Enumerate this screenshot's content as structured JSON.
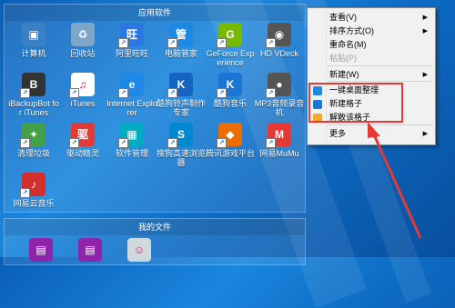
{
  "colors": {
    "accent_red": "#e53935",
    "menu_bg": "#f1f1f1",
    "fence_title_text": "#ffffff"
  },
  "fence_apps": {
    "title": "应用软件",
    "icons": [
      {
        "label": "计算机",
        "icon": "computer-icon",
        "color": "#3b7fc4",
        "glyph": "▣"
      },
      {
        "label": "回收站",
        "icon": "recycle-bin-icon",
        "color": "#7da7c9",
        "glyph": "♻"
      },
      {
        "label": "阿里旺旺",
        "icon": "aliwangwang-icon",
        "color": "#2b78e4",
        "glyph": "旺"
      },
      {
        "label": "电脑管家",
        "icon": "pc-manager-icon",
        "color": "#1e88e5",
        "glyph": "管"
      },
      {
        "label": "GeForce Experience",
        "icon": "geforce-icon",
        "color": "#76b900",
        "glyph": "G"
      },
      {
        "label": "HD VDeck",
        "icon": "hd-vdeck-icon",
        "color": "#555555",
        "glyph": "◉"
      },
      {
        "label": "iBackupBot for iTunes",
        "icon": "ibackupbot-icon",
        "color": "#333333",
        "glyph": "B"
      },
      {
        "label": "iTunes",
        "icon": "itunes-icon",
        "color": "#ffffff",
        "glyph": "♫"
      },
      {
        "label": "Internet Explorer",
        "icon": "ie-icon",
        "color": "#1e88e5",
        "glyph": "e"
      },
      {
        "label": "酷狗铃声制作专家",
        "icon": "kugou-ringtone-icon",
        "color": "#1565c0",
        "glyph": "K"
      },
      {
        "label": "酷狗音乐",
        "icon": "kugou-music-icon",
        "color": "#1976d2",
        "glyph": "K"
      },
      {
        "label": "MP3音频录音机",
        "icon": "mp3-recorder-icon",
        "color": "#555555",
        "glyph": "●"
      },
      {
        "label": "清理垃圾",
        "icon": "clean-trash-icon",
        "color": "#43a047",
        "glyph": "✦"
      },
      {
        "label": "驱动精灵",
        "icon": "driver-genius-icon",
        "color": "#e53935",
        "glyph": "驱"
      },
      {
        "label": "软件管理",
        "icon": "software-manager-icon",
        "color": "#00acc1",
        "glyph": "▦"
      },
      {
        "label": "搜狗高速浏览器",
        "icon": "sogou-browser-icon",
        "color": "#0288d1",
        "glyph": "S"
      },
      {
        "label": "腾讯游戏平台",
        "icon": "tencent-games-icon",
        "color": "#ef6c00",
        "glyph": "◆"
      },
      {
        "label": "网易MuMu",
        "icon": "netease-mumu-icon",
        "color": "#e53935",
        "glyph": "M"
      },
      {
        "label": "网易云音乐",
        "icon": "netease-music-icon",
        "color": "#d32f2f",
        "glyph": "♪"
      }
    ]
  },
  "fence_files": {
    "title": "我的文件",
    "icons": [
      {
        "label": "",
        "icon": "winrar-archive-icon",
        "color": "#8e24aa",
        "glyph": "▤"
      },
      {
        "label": "",
        "icon": "winrar-archive-icon",
        "color": "#8e24aa",
        "glyph": "▤"
      },
      {
        "label": "",
        "icon": "photo-icon",
        "color": "#cfd8dc",
        "glyph": "☺"
      }
    ]
  },
  "context_menu": {
    "items": [
      {
        "label": "查看(V)",
        "arrow": "▶",
        "disabled": false
      },
      {
        "label": "排序方式(O)",
        "arrow": "▶",
        "disabled": false
      },
      {
        "label": "重命名(M)",
        "arrow": "",
        "disabled": false
      },
      {
        "label": "粘贴(P)",
        "arrow": "",
        "disabled": true
      },
      {
        "label": "新建(W)",
        "arrow": "▶",
        "disabled": false
      },
      {
        "label": "一键桌面整理",
        "arrow": "",
        "disabled": false,
        "icon": "organize-desktop-icon",
        "icon_color": "#1e88e5"
      },
      {
        "label": "新建格子",
        "arrow": "",
        "disabled": false,
        "icon": "new-fence-icon",
        "icon_color": "#1976d2"
      },
      {
        "label": "解散该格子",
        "arrow": "",
        "disabled": false,
        "icon": "dissolve-fence-icon",
        "icon_color": "#f9a825"
      },
      {
        "label": "更多",
        "arrow": "▶",
        "disabled": false
      }
    ]
  }
}
